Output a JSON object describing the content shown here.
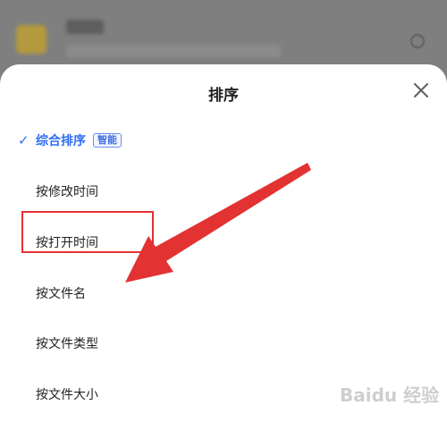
{
  "sheet": {
    "title": "排序",
    "close_icon": "close-icon"
  },
  "options": [
    {
      "label": "综合排序",
      "selected": true,
      "badge": "智能"
    },
    {
      "label": "按修改时间"
    },
    {
      "label": "按打开时间"
    },
    {
      "label": "按文件名"
    },
    {
      "label": "按文件类型"
    },
    {
      "label": "按文件大小"
    }
  ],
  "colors": {
    "accent": "#2f6ef6",
    "annotation_red": "#e23232"
  },
  "watermark": "Baidu 经验"
}
